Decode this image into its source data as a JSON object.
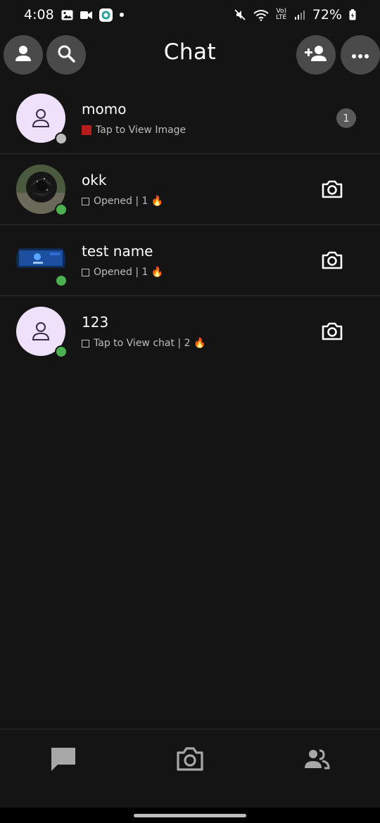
{
  "status_bar": {
    "time": "4:08",
    "battery": "72%",
    "network": "Vo) LTE"
  },
  "header": {
    "title": "Chat"
  },
  "chats": [
    {
      "name": "momo",
      "subtitle": "Tap to View Image",
      "indicator": "red-square",
      "badge": "1",
      "status_color": "#bdbdbd",
      "avatar": "default-user-avatar"
    },
    {
      "name": "okk",
      "subtitle": "Opened | 1 🔥",
      "indicator": "outline-square",
      "status_color": "#4caf50",
      "avatar": "black-rose-photo"
    },
    {
      "name": "test name",
      "subtitle": "Opened | 1 🔥",
      "indicator": "outline-square",
      "status_color": "#4caf50",
      "avatar": "screen-photo"
    },
    {
      "name": "123",
      "subtitle": "Tap to View chat | 2 🔥",
      "indicator": "outline-square",
      "status_color": "#4caf50",
      "avatar": "default-user-avatar"
    }
  ],
  "colors": {
    "background": "#141414",
    "button_bg": "#4a4a4a",
    "avatar_bg": "#efe1fa",
    "online": "#4caf50",
    "unread_indicator": "#b71c1c"
  },
  "icons": {
    "profile": "person-icon",
    "search": "search-icon",
    "add_friend": "add-friend-icon",
    "more": "more-icon",
    "camera": "camera-icon",
    "nav_chat": "chat-icon",
    "nav_camera": "camera-icon",
    "nav_friends": "friends-icon"
  }
}
